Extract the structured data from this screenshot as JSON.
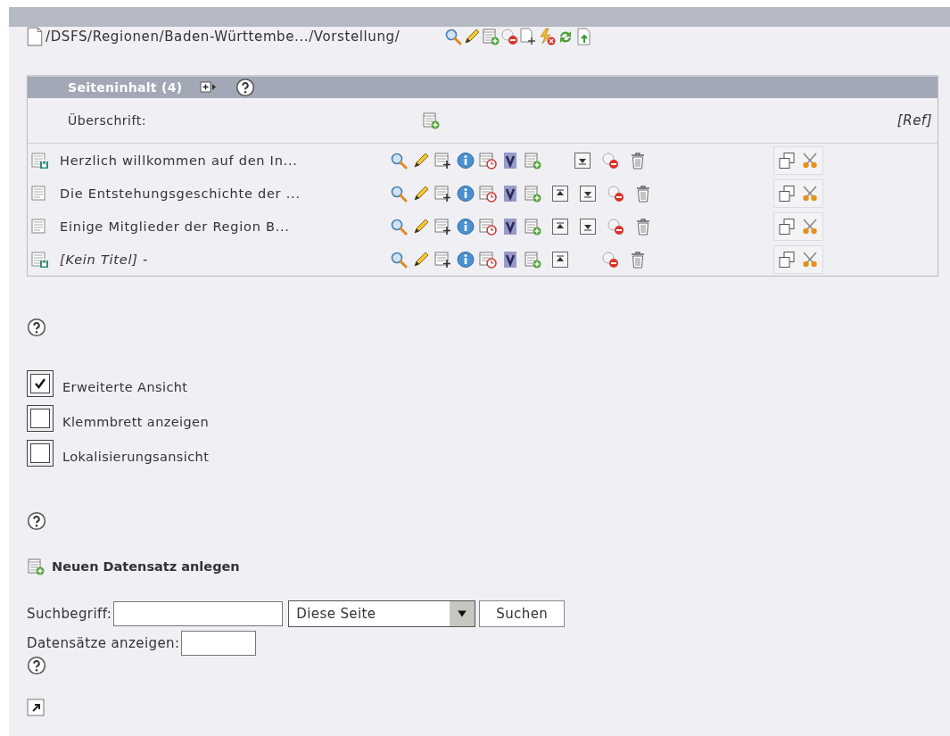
{
  "path": "/DSFS/Regionen/Baden-Württembe.../Vorstellung/",
  "panel": {
    "title": "Seiteninhalt (4)",
    "column_label": "Überschrift:",
    "ref_label": "[Ref]"
  },
  "rows": [
    {
      "title": "Herzlich willkommen auf den In...",
      "kind": "locked",
      "untitled": false,
      "can_move_up": false,
      "can_move_down": true
    },
    {
      "title": "Die Entstehungsgeschichte der ...",
      "kind": "plain",
      "untitled": false,
      "can_move_up": true,
      "can_move_down": true
    },
    {
      "title": "Einige Mitglieder der Region B...",
      "kind": "plain",
      "untitled": false,
      "can_move_up": true,
      "can_move_down": true
    },
    {
      "title": "[Kein Titel] -",
      "kind": "locked",
      "untitled": true,
      "can_move_up": true,
      "can_move_down": false
    }
  ],
  "options": [
    {
      "label": "Erweiterte Ansicht",
      "checked": true
    },
    {
      "label": "Klemmbrett anzeigen",
      "checked": false
    },
    {
      "label": "Lokalisierungsansicht",
      "checked": false
    }
  ],
  "new_record": "Neuen Datensatz anlegen",
  "search": {
    "label": "Suchbegriff:",
    "scope": "Diese Seite",
    "button": "Suchen",
    "count_label": "Datensätze anzeigen:"
  }
}
